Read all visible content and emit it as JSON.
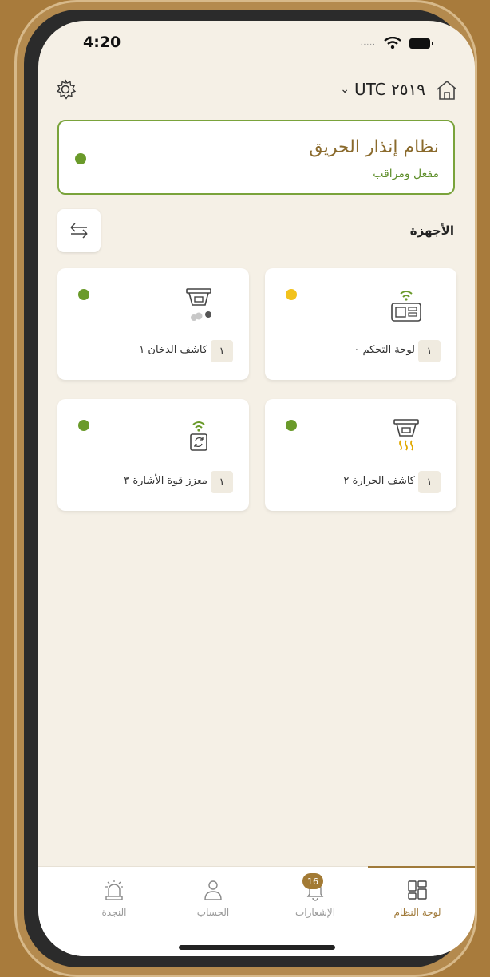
{
  "status_bar": {
    "time": "4:20",
    "signal_dots": "....."
  },
  "header": {
    "timezone": "UTC ٢٥١٩"
  },
  "alarm_system": {
    "title": "نظام إنذار الحريق",
    "status": "مفعل ومراقب",
    "status_color": "#6a9a2a"
  },
  "devices": {
    "section_label": "الأجهزة",
    "items": [
      {
        "name": "لوحة التحكم ٠",
        "index": "١",
        "status": "yellow",
        "icon": "control-panel-icon"
      },
      {
        "name": "كاشف الدخان ١",
        "index": "١",
        "status": "green",
        "icon": "smoke-detector-icon"
      },
      {
        "name": "كاشف الحرارة ٢",
        "index": "١",
        "status": "green",
        "icon": "heat-detector-icon"
      },
      {
        "name": "معزز قوة الأشارة ٣",
        "index": "١",
        "status": "green",
        "icon": "signal-booster-icon"
      }
    ]
  },
  "tabbar": {
    "tabs": [
      {
        "label": "لوحة النظام",
        "icon": "dashboard-icon",
        "active": true
      },
      {
        "label": "الإشعارات",
        "icon": "bell-icon",
        "badge": "16"
      },
      {
        "label": "الحساب",
        "icon": "user-icon"
      },
      {
        "label": "النجدة",
        "icon": "siren-icon"
      }
    ]
  },
  "colors": {
    "accent": "#a07a3a",
    "green": "#6a9a2a",
    "yellow": "#f2c21c",
    "frame": "#a87b3c"
  }
}
